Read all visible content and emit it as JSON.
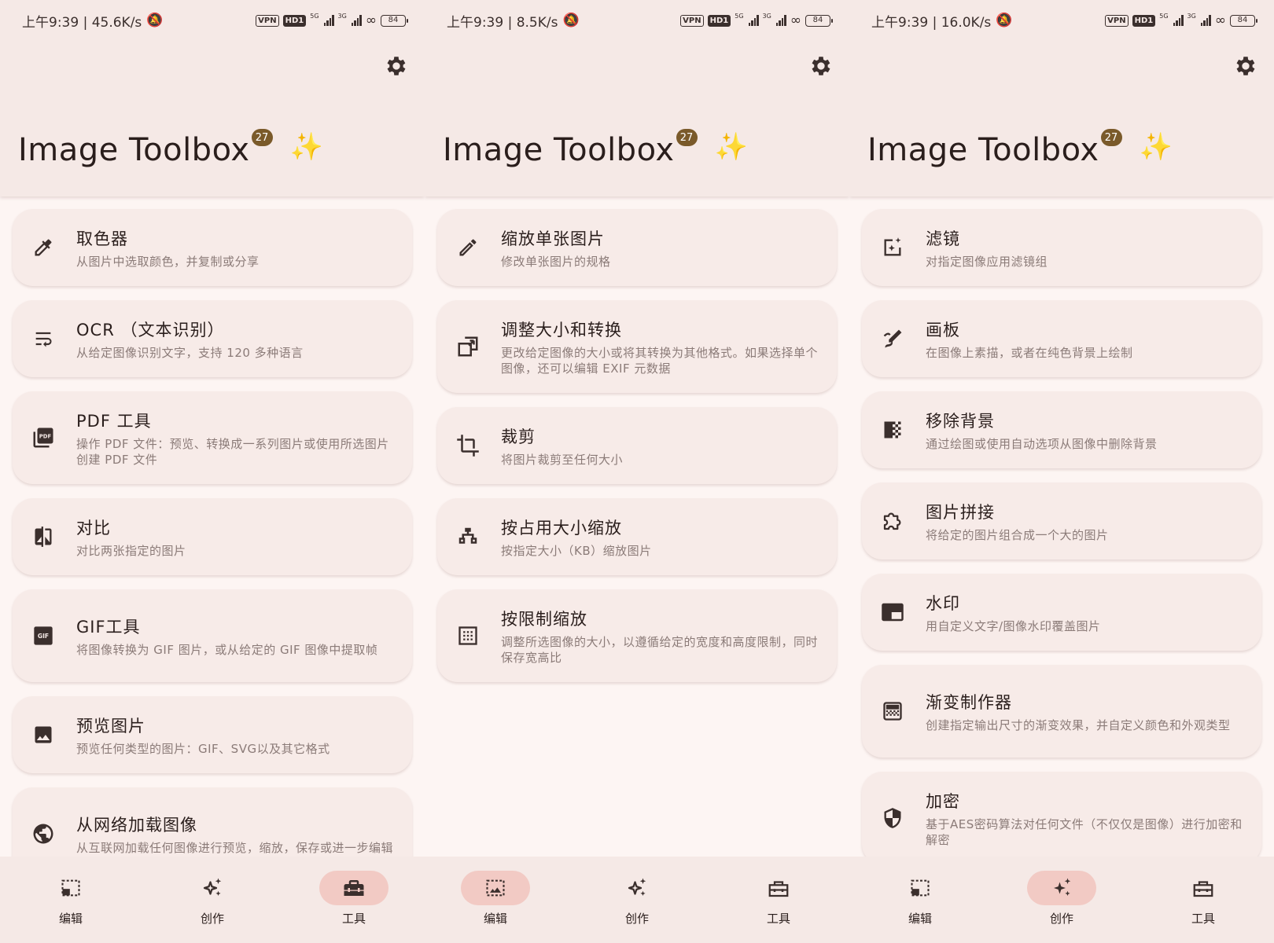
{
  "app": {
    "title": "Image Toolbox",
    "version_badge": "27",
    "sparkle": "✨"
  },
  "screens": [
    {
      "status": {
        "time": "上午9:39 | 45.6K/s",
        "battery": "84",
        "vpn": "VPN",
        "hd": "HD1",
        "net1": "5G",
        "net2": "3G"
      },
      "cards": [
        {
          "title": "取色器",
          "desc": "从图片中选取颜色，并复制或分享",
          "icon": "eyedropper-icon"
        },
        {
          "title": "OCR （文本识别）",
          "desc": "从给定图像识别文字，支持 120 多种语言",
          "icon": "text-wrap-icon"
        },
        {
          "title": "PDF 工具",
          "desc": "操作 PDF 文件：预览、转换成一系列图片或使用所选图片创建 PDF 文件",
          "icon": "pdf-icon"
        },
        {
          "title": "对比",
          "desc": "对比两张指定的图片",
          "icon": "compare-icon"
        },
        {
          "title": "GIF工具",
          "desc": "将图像转换为 GIF 图片，或从给定的 GIF 图像中提取帧",
          "icon": "gif-icon"
        },
        {
          "title": "预览图片",
          "desc": "预览任何类型的图片：GIF、SVG以及其它格式",
          "icon": "image-icon"
        },
        {
          "title": "从网络加载图像",
          "desc": "从互联网加载任何图像进行预览，缩放，保存或进一步编辑",
          "icon": "globe-icon"
        }
      ],
      "active_tab": 2
    },
    {
      "status": {
        "time": "上午9:39 | 8.5K/s",
        "battery": "84",
        "vpn": "VPN",
        "hd": "HD1",
        "net1": "5G",
        "net2": "3G"
      },
      "cards": [
        {
          "title": "缩放单张图片",
          "desc": "修改单张图片的规格",
          "icon": "pencil-icon"
        },
        {
          "title": "调整大小和转换",
          "desc": "更改给定图像的大小或将其转换为其他格式。如果选择单个图像，还可以编辑 EXIF 元数据",
          "icon": "resize-icon"
        },
        {
          "title": "裁剪",
          "desc": "将图片裁剪至任何大小",
          "icon": "crop-icon"
        },
        {
          "title": "按占用大小缩放",
          "desc": "按指定大小（KB）缩放图片",
          "icon": "weight-icon"
        },
        {
          "title": "按限制缩放",
          "desc": "调整所选图像的大小，以遵循给定的宽度和高度限制，同时保存宽高比",
          "icon": "grid-limit-icon"
        }
      ],
      "active_tab": 0
    },
    {
      "status": {
        "time": "上午9:39 | 16.0K/s",
        "battery": "84",
        "vpn": "VPN",
        "hd": "HD1",
        "net1": "5G",
        "net2": "3G"
      },
      "cards": [
        {
          "title": "滤镜",
          "desc": "对指定图像应用滤镜组",
          "icon": "filter-icon"
        },
        {
          "title": "画板",
          "desc": "在图像上素描，或者在纯色背景上绘制",
          "icon": "draw-icon"
        },
        {
          "title": "移除背景",
          "desc": "通过绘图或使用自动选项从图像中删除背景",
          "icon": "eraser-icon"
        },
        {
          "title": "图片拼接",
          "desc": "将给定的图片组合成一个大的图片",
          "icon": "puzzle-icon"
        },
        {
          "title": "水印",
          "desc": "用自定义文字/图像水印覆盖图片",
          "icon": "watermark-icon"
        },
        {
          "title": "渐变制作器",
          "desc": "创建指定输出尺寸的渐变效果，并自定义颜色和外观类型",
          "icon": "gradient-icon"
        },
        {
          "title": "加密",
          "desc": "基于AES密码算法对任何文件（不仅仅是图像）进行加密和解密",
          "icon": "shield-icon"
        }
      ],
      "active_tab": 1
    }
  ],
  "tabs": [
    {
      "label": "编辑",
      "icon": "edit-select-icon"
    },
    {
      "label": "创作",
      "icon": "sparkles-icon"
    },
    {
      "label": "工具",
      "icon": "toolbox-icon"
    }
  ],
  "colors": {
    "accent_pill": "#f2cac4",
    "card_bg": "#f7ebe8",
    "bar_bg": "#f5e9e6",
    "badge": "#7a5a2a"
  }
}
